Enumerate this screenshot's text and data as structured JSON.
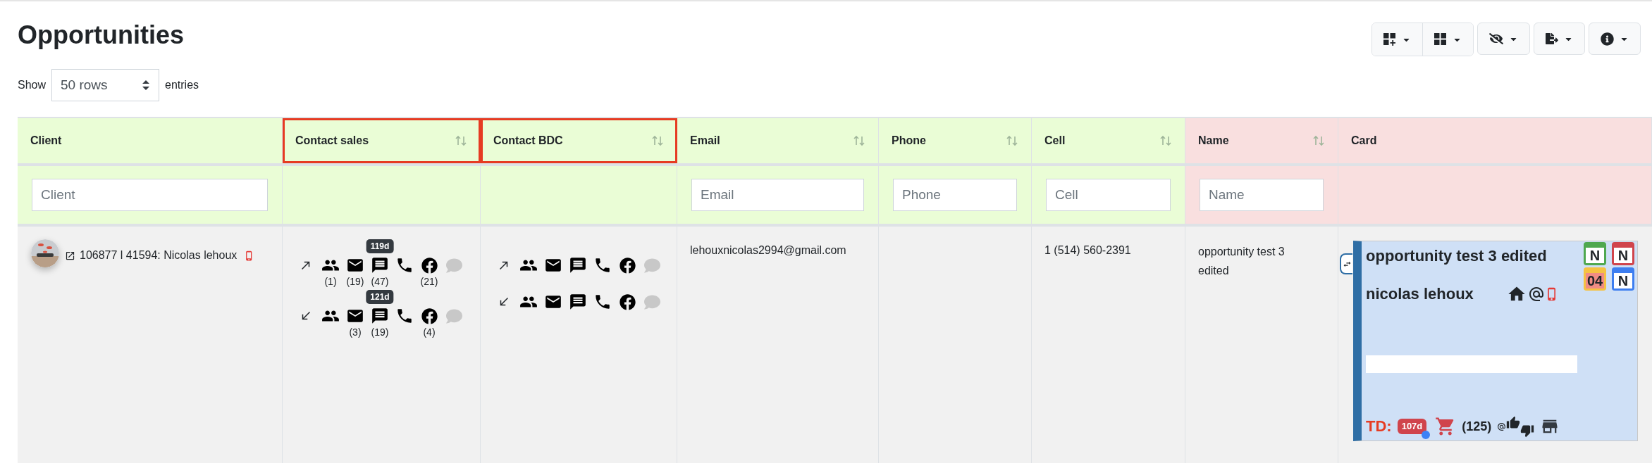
{
  "title": "Opportunities",
  "length_menu": {
    "label": "Show",
    "value": "50 rows",
    "suffix": "entries"
  },
  "columns": [
    {
      "label": "Client",
      "sortable": false,
      "highlighted": false,
      "color": "#eafdd6",
      "filter_placeholder": "Client"
    },
    {
      "label": "Contact sales",
      "sortable": true,
      "highlighted": true,
      "color": "#eafdd6"
    },
    {
      "label": "Contact BDC",
      "sortable": true,
      "highlighted": true,
      "color": "#eafdd6"
    },
    {
      "label": "Email",
      "sortable": true,
      "highlighted": false,
      "color": "#eafdd6",
      "filter_placeholder": "Email"
    },
    {
      "label": "Phone",
      "sortable": true,
      "highlighted": false,
      "color": "#eafdd6",
      "filter_placeholder": "Phone"
    },
    {
      "label": "Cell",
      "sortable": true,
      "highlighted": false,
      "color": "#eafdd6",
      "filter_placeholder": "Cell"
    },
    {
      "label": "Name",
      "sortable": true,
      "highlighted": false,
      "color": "#f9dfdf",
      "filter_placeholder": "Name"
    },
    {
      "label": "Card",
      "sortable": false,
      "highlighted": false,
      "color": "#f9dfdf"
    }
  ],
  "row": {
    "client": "106877 l 41594: Nicolas lehoux",
    "contact_sales": [
      {
        "kind": "outgoing",
        "items": [
          {
            "kind": "people",
            "count": "(1)"
          },
          {
            "kind": "email",
            "count": "(19)"
          },
          {
            "kind": "sms",
            "count": "(47)",
            "badge": "119d"
          },
          {
            "kind": "phone"
          },
          {
            "kind": "facebook",
            "count": "(21)"
          },
          {
            "kind": "chat",
            "disabled": true
          }
        ]
      },
      {
        "kind": "incoming",
        "items": [
          {
            "kind": "people"
          },
          {
            "kind": "email",
            "count": "(3)"
          },
          {
            "kind": "sms",
            "count": "(19)",
            "badge": "121d"
          },
          {
            "kind": "phone"
          },
          {
            "kind": "facebook",
            "count": "(4)"
          },
          {
            "kind": "chat",
            "disabled": true
          }
        ]
      }
    ],
    "contact_bdc": [
      {
        "kind": "outgoing",
        "items": [
          {
            "kind": "people"
          },
          {
            "kind": "email"
          },
          {
            "kind": "sms"
          },
          {
            "kind": "phone"
          },
          {
            "kind": "facebook"
          },
          {
            "kind": "chat",
            "disabled": true
          }
        ]
      },
      {
        "kind": "incoming",
        "items": [
          {
            "kind": "people"
          },
          {
            "kind": "email"
          },
          {
            "kind": "sms"
          },
          {
            "kind": "phone"
          },
          {
            "kind": "facebook"
          },
          {
            "kind": "chat",
            "disabled": true
          }
        ]
      }
    ],
    "email": "lehouxnicolas2994@gmail.com",
    "cell": "1 (514) 560-2391",
    "name": "opportunity test 3 edited",
    "card": {
      "title": "opportunity test 3 edited",
      "client_name": "nicolas lehoux",
      "calendars": [
        {
          "text": "N",
          "color": "#4fa84f",
          "highlighted": false
        },
        {
          "text": "N",
          "color": "#d0444c",
          "highlighted": false
        },
        {
          "text": "04",
          "color": "#f5c242",
          "highlighted": true
        },
        {
          "text": "N",
          "color": "#3d7ef0",
          "highlighted": false
        }
      ],
      "td_label": "TD:",
      "days_badge": "107d",
      "count": "(125)"
    }
  }
}
